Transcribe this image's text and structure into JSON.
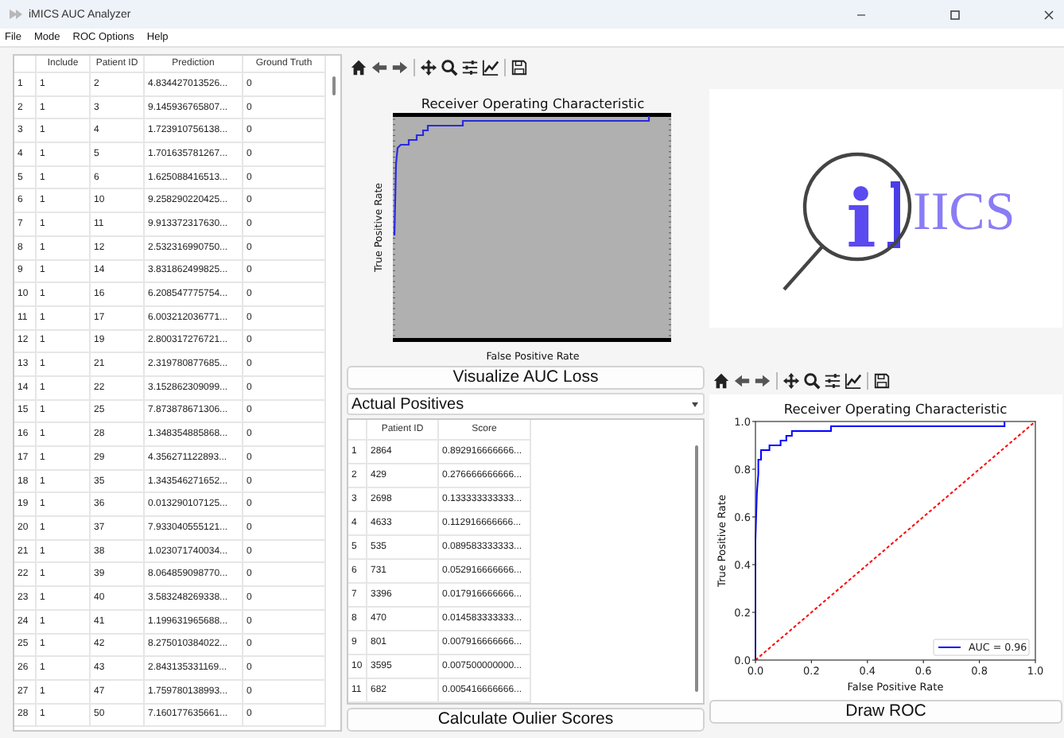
{
  "window": {
    "title": "iMICS AUC Analyzer"
  },
  "menu": [
    "File",
    "Mode",
    "ROC Options",
    "Help"
  ],
  "patients_table": {
    "columns": [
      "Include",
      "Patient ID",
      "Prediction",
      "Ground Truth"
    ],
    "rows": [
      {
        "index": "1",
        "cells": [
          "1",
          "2",
          "4.834427013526...",
          "0"
        ]
      },
      {
        "index": "2",
        "cells": [
          "1",
          "3",
          "9.145936765807...",
          "0"
        ]
      },
      {
        "index": "3",
        "cells": [
          "1",
          "4",
          "1.723910756138...",
          "0"
        ]
      },
      {
        "index": "4",
        "cells": [
          "1",
          "5",
          "1.701635781267...",
          "0"
        ]
      },
      {
        "index": "5",
        "cells": [
          "1",
          "6",
          "1.625088416513...",
          "0"
        ]
      },
      {
        "index": "6",
        "cells": [
          "1",
          "10",
          "9.258290220425...",
          "0"
        ]
      },
      {
        "index": "7",
        "cells": [
          "1",
          "11",
          "9.913372317630...",
          "0"
        ]
      },
      {
        "index": "8",
        "cells": [
          "1",
          "12",
          "2.532316990750...",
          "0"
        ]
      },
      {
        "index": "9",
        "cells": [
          "1",
          "14",
          "3.831862499825...",
          "0"
        ]
      },
      {
        "index": "10",
        "cells": [
          "1",
          "16",
          "6.208547775754...",
          "0"
        ]
      },
      {
        "index": "11",
        "cells": [
          "1",
          "17",
          "6.003212036771...",
          "0"
        ]
      },
      {
        "index": "12",
        "cells": [
          "1",
          "19",
          "2.800317276721...",
          "0"
        ]
      },
      {
        "index": "13",
        "cells": [
          "1",
          "21",
          "2.319780877685...",
          "0"
        ]
      },
      {
        "index": "14",
        "cells": [
          "1",
          "22",
          "3.152862309099...",
          "0"
        ]
      },
      {
        "index": "15",
        "cells": [
          "1",
          "25",
          "7.873878671306...",
          "0"
        ]
      },
      {
        "index": "16",
        "cells": [
          "1",
          "28",
          "1.348354885868...",
          "0"
        ]
      },
      {
        "index": "17",
        "cells": [
          "1",
          "29",
          "4.356271122893...",
          "0"
        ]
      },
      {
        "index": "18",
        "cells": [
          "1",
          "35",
          "1.343546271652...",
          "0"
        ]
      },
      {
        "index": "19",
        "cells": [
          "1",
          "36",
          "0.013290107125...",
          "0"
        ]
      },
      {
        "index": "20",
        "cells": [
          "1",
          "37",
          "7.933040555121...",
          "0"
        ]
      },
      {
        "index": "21",
        "cells": [
          "1",
          "38",
          "1.023071740034...",
          "0"
        ]
      },
      {
        "index": "22",
        "cells": [
          "1",
          "39",
          "8.064859098770...",
          "0"
        ]
      },
      {
        "index": "23",
        "cells": [
          "1",
          "40",
          "3.583248269338...",
          "0"
        ]
      },
      {
        "index": "24",
        "cells": [
          "1",
          "41",
          "1.199631965688...",
          "0"
        ]
      },
      {
        "index": "25",
        "cells": [
          "1",
          "42",
          "8.275010384022...",
          "0"
        ]
      },
      {
        "index": "26",
        "cells": [
          "1",
          "43",
          "2.843135331169...",
          "0"
        ]
      },
      {
        "index": "27",
        "cells": [
          "1",
          "47",
          "1.759780138993...",
          "0"
        ]
      },
      {
        "index": "28",
        "cells": [
          "1",
          "50",
          "7.160177635661...",
          "0"
        ]
      }
    ]
  },
  "loss_plot": {
    "title": "Receiver Operating Characteristic",
    "xlabel": "False Positive Rate",
    "ylabel": "True Positive Rate"
  },
  "visualize_button": "Visualize AUC Loss",
  "positives_dropdown": {
    "value": "Actual Positives"
  },
  "positives_table": {
    "columns": [
      "Patient ID",
      "Score"
    ],
    "rows": [
      {
        "index": "1",
        "cells": [
          "2864",
          "0.892916666666..."
        ]
      },
      {
        "index": "2",
        "cells": [
          "429",
          "0.276666666666..."
        ]
      },
      {
        "index": "3",
        "cells": [
          "2698",
          "0.133333333333..."
        ]
      },
      {
        "index": "4",
        "cells": [
          "4633",
          "0.112916666666..."
        ]
      },
      {
        "index": "5",
        "cells": [
          "535",
          "0.089583333333..."
        ]
      },
      {
        "index": "6",
        "cells": [
          "731",
          "0.052916666666..."
        ]
      },
      {
        "index": "7",
        "cells": [
          "3396",
          "0.017916666666..."
        ]
      },
      {
        "index": "8",
        "cells": [
          "470",
          "0.014583333333..."
        ]
      },
      {
        "index": "9",
        "cells": [
          "801",
          "0.007916666666..."
        ]
      },
      {
        "index": "10",
        "cells": [
          "3595",
          "0.007500000000..."
        ]
      },
      {
        "index": "11",
        "cells": [
          "682",
          "0.005416666666..."
        ]
      }
    ]
  },
  "outlier_button": "Calculate Oulier Scores",
  "logo": {
    "lens_text": "i",
    "text": "IICS"
  },
  "roc_chart": {
    "chart_data": {
      "type": "line",
      "title": "Receiver Operating Characteristic",
      "xlabel": "False Positive Rate",
      "ylabel": "True Positive Rate",
      "x": [
        0,
        0,
        0.005,
        0.01,
        0.01,
        0.02,
        0.02,
        0.05,
        0.05,
        0.09,
        0.09,
        0.11,
        0.11,
        0.13,
        0.13,
        0.27,
        0.27,
        0.89,
        0.89,
        1
      ],
      "series": [
        {
          "name": "AUC = 0.96",
          "color": "#0000ff",
          "line_style": "solid",
          "values": [
            0,
            0.5,
            0.7,
            0.78,
            0.84,
            0.84,
            0.88,
            0.88,
            0.9,
            0.9,
            0.92,
            0.92,
            0.94,
            0.94,
            0.96,
            0.96,
            0.98,
            0.98,
            1,
            null
          ]
        },
        {
          "color": "#ff0000",
          "line_style": "dashed",
          "values": [
            0,
            0,
            0.005,
            0.01,
            0.01,
            0.02,
            0.02,
            0.05,
            0.05,
            0.09,
            0.09,
            0.11,
            0.11,
            0.13,
            0.13,
            0.27,
            0.27,
            0.89,
            0.89,
            1
          ]
        }
      ],
      "xlim": [
        0,
        1
      ],
      "ylim": [
        0,
        1
      ],
      "xticks": [
        {
          "value": 0,
          "label": "0.0"
        },
        {
          "value": 0.2,
          "label": "0.2"
        },
        {
          "value": 0.4,
          "label": "0.4"
        },
        {
          "value": 0.6,
          "label": "0.6"
        },
        {
          "value": 0.8,
          "label": "0.8"
        },
        {
          "value": 1,
          "label": "1.0"
        }
      ],
      "yticks": [
        {
          "value": 0,
          "label": "0.0"
        },
        {
          "value": 0.2,
          "label": "0.2"
        },
        {
          "value": 0.4,
          "label": "0.4"
        },
        {
          "value": 0.6,
          "label": "0.6"
        },
        {
          "value": 0.8,
          "label": "0.8"
        },
        {
          "value": 1,
          "label": "1.0"
        }
      ]
    }
  },
  "draw_button": "Draw ROC"
}
